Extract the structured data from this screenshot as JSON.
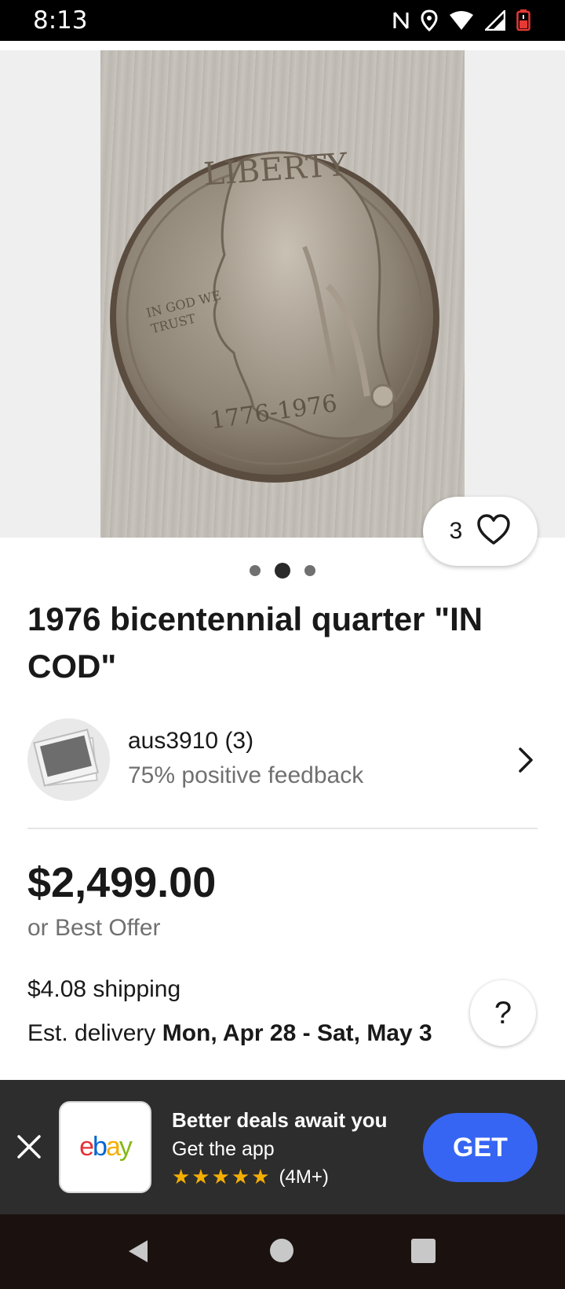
{
  "status_bar": {
    "time": "8:13",
    "icons": [
      "nfc-icon",
      "location-icon",
      "wifi-icon",
      "signal-icon",
      "battery-icon"
    ]
  },
  "listing": {
    "image_count": 3,
    "active_image_index": 1,
    "photo_lettering": [
      "LIBERTY",
      "IN GOD WE TRUST",
      "1776-1976"
    ],
    "watch_count": "3",
    "title": "1976 bicentennial quarter \"IN COD\"",
    "seller": {
      "name": "aus3910 (3)",
      "feedback": "75% positive feedback"
    },
    "price": "$2,499.00",
    "best_offer": "or Best Offer",
    "shipping": "$4.08 shipping",
    "delivery_prefix": "Est. delivery ",
    "delivery_dates": "Mon, Apr 28 - Sat, May 3",
    "help_label": "?"
  },
  "app_banner": {
    "logo_text": "ebay",
    "title": "Better deals await you",
    "subtitle": "Get the app",
    "stars": "★★★★★",
    "rating_count": "(4M+)",
    "get_label": "GET"
  },
  "colors": {
    "accent_blue": "#3665f3",
    "star_yellow": "#f5af02",
    "banner_bg": "#2d2d2d",
    "secondary_text": "#707070"
  }
}
